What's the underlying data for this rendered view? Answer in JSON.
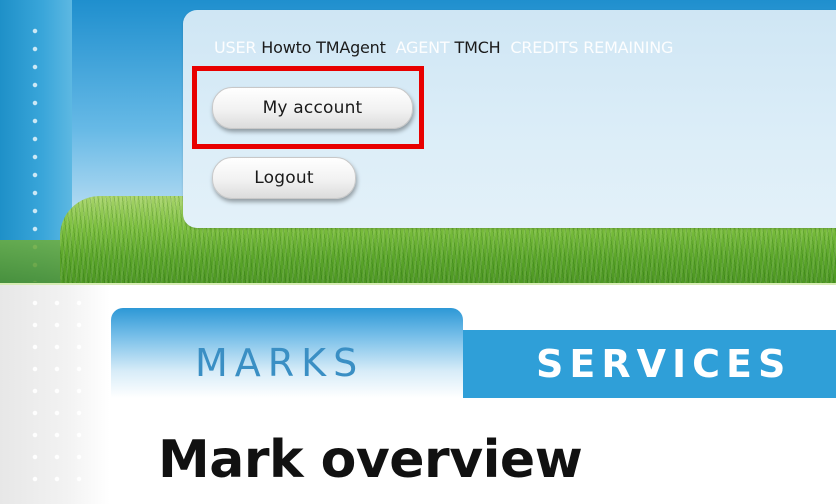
{
  "header": {
    "user_label": "USER",
    "user_value": "Howto TMAgent",
    "agent_label": "AGENT",
    "agent_value": "TMCH",
    "credits_label": "CREDITS REMAINING",
    "buttons": {
      "account": "My account",
      "logout": "Logout"
    }
  },
  "tabs": [
    {
      "label": "MARKS",
      "active": true
    },
    {
      "label": "SERVICES",
      "active": false
    }
  ],
  "main": {
    "title": "Mark overview"
  },
  "colors": {
    "accent_blue": "#2f9fd8",
    "highlight_red": "#e80000",
    "grass_green": "#5aa529"
  }
}
